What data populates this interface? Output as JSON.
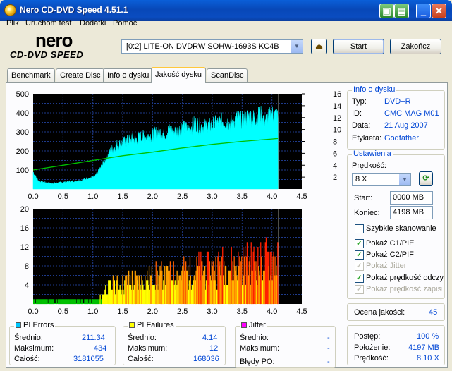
{
  "window": {
    "title": "Nero CD-DVD Speed 4.51.1"
  },
  "menu": [
    "Plik",
    "Uruchom test",
    "Dodatki",
    "Pomoc"
  ],
  "logo": {
    "brand": "nero",
    "product": "CD-DVD SPEED"
  },
  "drive": {
    "selected": "[0:2]  LITE-ON DVDRW SOHW-1693S KC4B"
  },
  "buttons": {
    "start": "Start",
    "close": "Zakończ"
  },
  "tabs": [
    "Benchmark",
    "Create Disc",
    "Info o dysku",
    "Jakość dysku",
    "ScanDisc"
  ],
  "active_tab": "Jakość dysku",
  "top_chart": {
    "y_left_ticks": [
      "500",
      "400",
      "300",
      "200",
      "100"
    ],
    "y_right_ticks": [
      "16",
      "14",
      "12",
      "10",
      "8",
      "6",
      "4",
      "2"
    ],
    "x_ticks": [
      "0.0",
      "0.5",
      "1.0",
      "1.5",
      "2.0",
      "2.5",
      "3.0",
      "3.5",
      "4.0",
      "4.5"
    ]
  },
  "bottom_chart": {
    "y_ticks": [
      "20",
      "16",
      "12",
      "8",
      "4"
    ],
    "x_ticks": [
      "0.0",
      "0.5",
      "1.0",
      "1.5",
      "2.0",
      "2.5",
      "3.0",
      "3.5",
      "4.0",
      "4.5"
    ]
  },
  "chart_data": [
    {
      "type": "area",
      "title": "",
      "xlabel": "",
      "ylabel": "",
      "xlim": [
        0,
        4.5
      ],
      "ylim": [
        0,
        500
      ],
      "y2lim": [
        0,
        16
      ],
      "series": [
        {
          "values_x": [
            0.0,
            0.05,
            0.1,
            0.2,
            0.3,
            0.4,
            0.5,
            0.6,
            0.7,
            0.8,
            0.9,
            1.0,
            1.05,
            1.1,
            1.15,
            1.2,
            1.3,
            1.4,
            1.5,
            1.6,
            1.7,
            1.8,
            1.9,
            2.0,
            2.1,
            2.2,
            2.3,
            2.4,
            2.5,
            2.6,
            2.7,
            2.8,
            2.9,
            3.0,
            3.1,
            3.2,
            3.3,
            3.4,
            3.5,
            3.6,
            3.7,
            3.8,
            3.9,
            4.0,
            4.1
          ],
          "values_y": [
            90,
            60,
            40,
            35,
            30,
            32,
            35,
            40,
            42,
            45,
            55,
            60,
            70,
            95,
            120,
            150,
            200,
            230,
            240,
            255,
            260,
            270,
            275,
            280,
            300,
            290,
            310,
            300,
            320,
            310,
            340,
            330,
            325,
            335,
            345,
            360,
            340,
            370,
            360,
            380,
            370,
            390,
            360,
            395,
            380
          ],
          "color": "#00ffff"
        },
        {
          "values_x": [
            0.0,
            0.5,
            1.0,
            1.5,
            2.0,
            2.5,
            3.0,
            3.5,
            4.0,
            4.1
          ],
          "values_y": [
            3.2,
            4.0,
            4.8,
            5.6,
            6.2,
            6.9,
            7.5,
            8.0,
            8.4,
            8.5
          ],
          "color": "#00c000"
        }
      ]
    },
    {
      "type": "bar",
      "title": "",
      "xlabel": "",
      "ylabel": "",
      "xlim": [
        0,
        4.5
      ],
      "ylim": [
        0,
        20
      ],
      "series": [
        {
          "values_x": [
            0.0,
            0.2,
            0.4,
            0.6,
            0.8,
            1.0,
            1.1,
            1.2,
            1.4,
            1.6,
            1.8,
            2.0,
            2.2,
            2.4,
            2.6,
            2.8,
            3.0,
            3.2,
            3.4,
            3.6,
            3.8,
            4.0,
            4.1
          ],
          "values_y": [
            1,
            1,
            1,
            1,
            1,
            1,
            1,
            4,
            5,
            6,
            6,
            7,
            7,
            8,
            8,
            9,
            9,
            10,
            10,
            11,
            11,
            12,
            12
          ]
        }
      ]
    }
  ],
  "disc_info": {
    "title": "Info o dysku",
    "rows": [
      {
        "label": "Typ:",
        "value": "DVD+R"
      },
      {
        "label": "ID:",
        "value": "CMC MAG M01"
      },
      {
        "label": "Data:",
        "value": "21 Aug 2007"
      },
      {
        "label": "Etykieta:",
        "value": "Godfather"
      }
    ]
  },
  "settings": {
    "title": "Ustawienia",
    "speed_label": "Prędkość:",
    "speed_value": "8 X",
    "start_label": "Start:",
    "start_value": "0000 MB",
    "end_label": "Koniec:",
    "end_value": "4198 MB",
    "checks": [
      {
        "label": "Szybkie skanowanie",
        "checked": false,
        "enabled": true
      },
      {
        "label": "Pokaż C1/PIE",
        "checked": true,
        "enabled": true
      },
      {
        "label": "Pokaż C2/PIF",
        "checked": true,
        "enabled": true
      },
      {
        "label": "Pokaż Jitter",
        "checked": true,
        "enabled": false
      },
      {
        "label": "Pokaż prędkość odczy",
        "checked": true,
        "enabled": true
      },
      {
        "label": "Pokaż prędkość zapisu",
        "checked": true,
        "enabled": false
      }
    ]
  },
  "quality": {
    "label": "Ocena jakości:",
    "value": "45"
  },
  "progress": {
    "rows": [
      {
        "label": "Postęp:",
        "value": "100 %"
      },
      {
        "label": "Położenie:",
        "value": "4197 MB"
      },
      {
        "label": "Prędkość:",
        "value": "8.10 X"
      }
    ]
  },
  "pi_errors": {
    "title": "PI Errors",
    "color": "#00c8ff",
    "rows": [
      {
        "label": "Średnio:",
        "value": "211.34"
      },
      {
        "label": "Maksimum:",
        "value": "434"
      },
      {
        "label": "Całość:",
        "value": "3181055"
      }
    ]
  },
  "pi_failures": {
    "title": "PI Failures",
    "color": "#ffff00",
    "rows": [
      {
        "label": "Średnio:",
        "value": "4.14"
      },
      {
        "label": "Maksimum:",
        "value": "12"
      },
      {
        "label": "Całość:",
        "value": "168036"
      }
    ]
  },
  "jitter": {
    "title": "Jitter",
    "color": "#ff00ff",
    "rows": [
      {
        "label": "Średnio:",
        "value": "-"
      },
      {
        "label": "Maksimum:",
        "value": "-"
      }
    ],
    "po_label": "Błędy PO:",
    "po_value": "-"
  }
}
